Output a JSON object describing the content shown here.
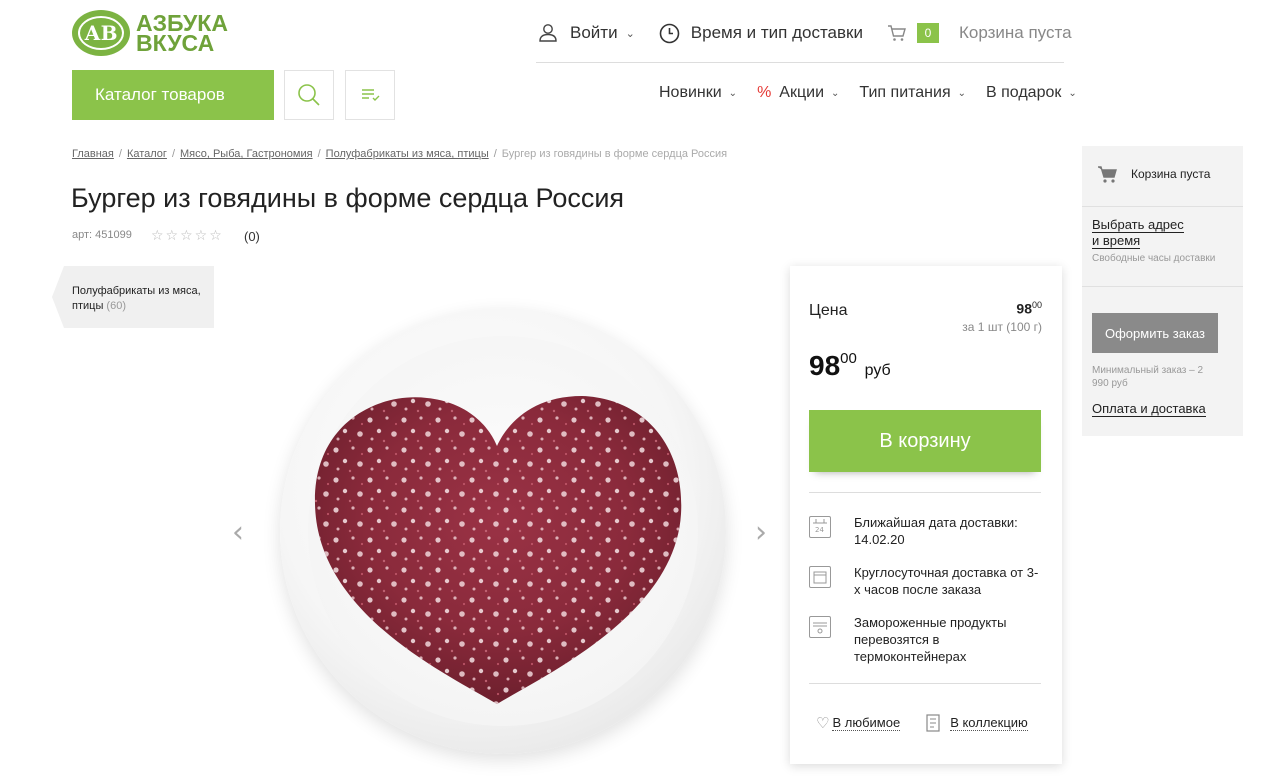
{
  "logo": {
    "line1": "АЗБУКА",
    "line2": "ВКУСА",
    "mark": "АВ"
  },
  "header": {
    "login": "Войти",
    "delivery": "Время и тип доставки",
    "cart_count": "0",
    "cart_status": "Корзина пуста"
  },
  "catalog_button": "Каталог товаров",
  "sub_nav": {
    "new": "Новинки",
    "sale_symbol": "%",
    "sale": "Акции",
    "diet": "Тип питания",
    "gift": "В подарок"
  },
  "breadcrumb": {
    "items": [
      "Главная",
      "Каталог",
      "Мясо, Рыба, Гастрономия",
      "Полуфабрикаты из мяса, птицы"
    ],
    "current": "Бургер из говядины в форме сердца Россия"
  },
  "product": {
    "title": "Бургер из говядины в форме сердца Россия",
    "sku": "арт: 451099",
    "stars": "☆☆☆☆☆",
    "reviews": "(0)"
  },
  "category_tag": {
    "name": "Полуфабрикаты из мяса, птицы",
    "count": "(60)"
  },
  "price_card": {
    "label": "Цена",
    "small_price_int": "98",
    "small_price_frac": "00",
    "unit": "за 1 шт (100 г)",
    "big_int": "98",
    "big_frac": "00",
    "currency": "руб",
    "add_to_cart": "В корзину",
    "info": [
      {
        "icon": "calendar-icon",
        "text": "Ближайшая дата доставки: 14.02.20"
      },
      {
        "icon": "clock-icon",
        "text": "Круглосуточная доставка от 3-х часов после заказа"
      },
      {
        "icon": "thermo-container-icon",
        "text": "Замороженные продукты перевозятся в термоконтейнерах"
      }
    ],
    "favorite": "В любимое",
    "collection": "В коллекцию"
  },
  "sidebar": {
    "cart": "Корзина пуста",
    "address_line1": "Выбрать адрес",
    "address_line2": "и время",
    "hours": "Свободные часы доставки",
    "order_button": "Оформить заказ",
    "min_order": "Минимальный заказ – 2 990 руб",
    "payment": "Оплата и доставка"
  },
  "colors": {
    "brand_green": "#8bc34a",
    "logo_green": "#6fa23a",
    "sale_red": "#e53935",
    "disabled_gray": "#8a8a8a"
  }
}
